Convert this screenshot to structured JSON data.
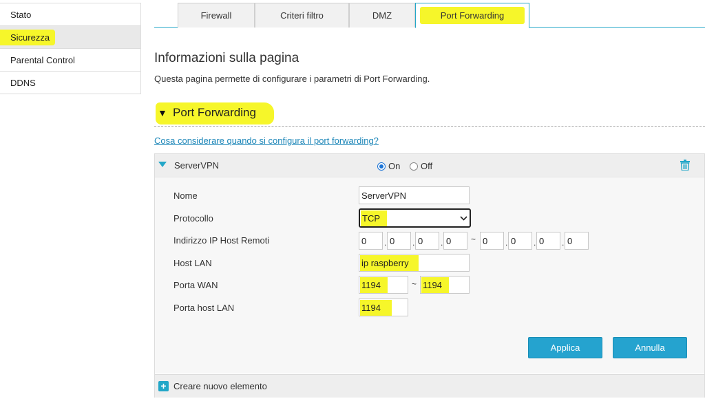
{
  "sidebar": {
    "items": [
      {
        "label": "Stato"
      },
      {
        "label": "Sicurezza"
      },
      {
        "label": "Parental Control"
      },
      {
        "label": "DDNS"
      }
    ]
  },
  "tabs": [
    {
      "label": "Firewall"
    },
    {
      "label": "Criteri filtro"
    },
    {
      "label": "DMZ"
    },
    {
      "label": "Port Forwarding"
    }
  ],
  "page": {
    "title": "Informazioni sulla pagina",
    "description": "Questa pagina permette di configurare i parametri di Port Forwarding."
  },
  "section": {
    "title": "Port Forwarding",
    "help_link": "Cosa considerare quando si configura il port forwarding?"
  },
  "rule": {
    "name": "ServerVPN",
    "on_label": "On",
    "off_label": "Off",
    "enabled": true,
    "fields": {
      "nome_label": "Nome",
      "nome_value": "ServerVPN",
      "protocollo_label": "Protocollo",
      "protocollo_value": "TCP",
      "ip_label": "Indirizzo IP Host Remoti",
      "ip_start": [
        "0",
        "0",
        "0",
        "0"
      ],
      "ip_end": [
        "0",
        "0",
        "0",
        "0"
      ],
      "ip_dot": ".",
      "range_sep": "~",
      "host_lan_label": "Host LAN",
      "host_lan_value": "ip raspberry",
      "porta_wan_label": "Porta WAN",
      "porta_wan_start": "1194",
      "porta_wan_end": "1194",
      "porta_host_label": "Porta host LAN",
      "porta_host_value": "1194"
    },
    "apply_label": "Applica",
    "cancel_label": "Annulla"
  },
  "footer": {
    "add_label": "Creare nuovo elemento"
  },
  "colors": {
    "accent": "#23a7c8",
    "highlight": "#f6f62a",
    "button": "#25a3cf"
  }
}
